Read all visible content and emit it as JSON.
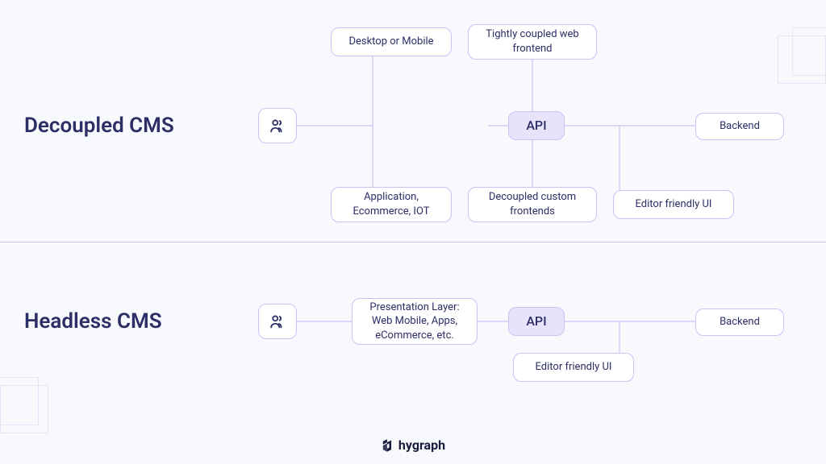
{
  "titles": {
    "decoupled": "Decoupled CMS",
    "headless": "Headless CMS"
  },
  "decoupled": {
    "desktop_mobile": "Desktop or Mobile",
    "tight_frontend": "Tightly coupled web frontend",
    "application": "Application, Ecommerce, IOT",
    "decoupled_front": "Decoupled custom frontends",
    "api": "API",
    "editor_ui": "Editor friendly UI",
    "backend": "Backend"
  },
  "headless": {
    "presentation": "Presentation Layer: Web Mobile, Apps, eCommerce, etc.",
    "api": "API",
    "editor_ui": "Editor friendly UI",
    "backend": "Backend"
  },
  "brand": "hygraph",
  "colors": {
    "bg": "#f8f9fc",
    "border": "#c9c3f5",
    "api_fill": "#e6e3fa",
    "text": "#2c2e66"
  }
}
